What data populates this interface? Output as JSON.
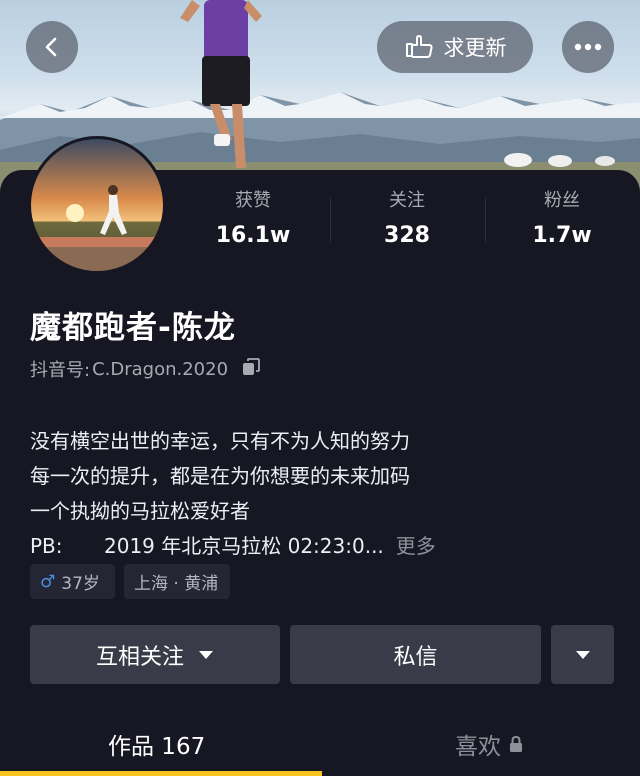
{
  "header": {
    "back_icon": "chevron-left-icon",
    "update_label": "求更新",
    "update_icon": "pointing-hand-icon",
    "more_icon": "more-dots-icon"
  },
  "profile": {
    "name": "魔都跑者-陈龙",
    "douyin_id_label": "抖音号:",
    "douyin_id": "C.Dragon.2020"
  },
  "stats": {
    "likes_label": "获赞",
    "likes_value": "16.1w",
    "following_label": "关注",
    "following_value": "328",
    "fans_label": "粉丝",
    "fans_value": "1.7w"
  },
  "bio": {
    "line1": "没有横空出世的幸运，只有不为人知的努力",
    "line2": "每一次的提升，都是在为你想要的未来加码",
    "line3": "一个执拗的马拉松爱好者",
    "pb_label": "PB:",
    "pb_value": "2019 年北京马拉松 02:23:0...",
    "more_label": "更多"
  },
  "tags": {
    "gender_symbol": "♂",
    "age": "37岁",
    "location": "上海 · 黄浦"
  },
  "actions": {
    "follow_label": "互相关注",
    "message_label": "私信"
  },
  "tabs": {
    "works_label": "作品 167",
    "likes_label": "喜欢"
  },
  "colors": {
    "background": "#161723",
    "button": "#3a3b48",
    "tag": "#252634",
    "accent_underline": "#f7c31c",
    "gender": "#4a90e2"
  }
}
